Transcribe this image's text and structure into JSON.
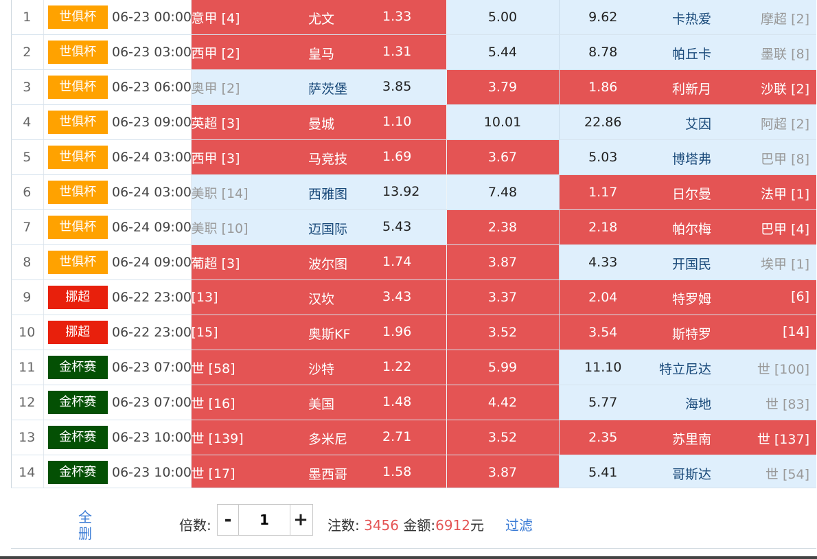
{
  "league_colors": {
    "世俱杯": "#ffa200",
    "挪超": "#e8200c",
    "金杯赛": "#045004"
  },
  "matches": [
    {
      "no": "1",
      "league": "世俱杯",
      "time": "06-23 00:00",
      "home_rank": "意甲 [4]",
      "home": "尤文",
      "home_odds": "1.33",
      "draw_odds": "5.00",
      "away_odds": "9.62",
      "away": "卡热爱",
      "away_rank": "摩超 [2]",
      "sel": [
        1,
        0,
        0
      ]
    },
    {
      "no": "2",
      "league": "世俱杯",
      "time": "06-23 03:00",
      "home_rank": "西甲 [2]",
      "home": "皇马",
      "home_odds": "1.31",
      "draw_odds": "5.44",
      "away_odds": "8.78",
      "away": "帕丘卡",
      "away_rank": "墨联 [8]",
      "sel": [
        1,
        0,
        0
      ]
    },
    {
      "no": "3",
      "league": "世俱杯",
      "time": "06-23 06:00",
      "home_rank": "奥甲 [2]",
      "home": "萨茨堡",
      "home_odds": "3.85",
      "draw_odds": "3.79",
      "away_odds": "1.86",
      "away": "利新月",
      "away_rank": "沙联 [2]",
      "sel": [
        0,
        1,
        1
      ]
    },
    {
      "no": "4",
      "league": "世俱杯",
      "time": "06-23 09:00",
      "home_rank": "英超 [3]",
      "home": "曼城",
      "home_odds": "1.10",
      "draw_odds": "10.01",
      "away_odds": "22.86",
      "away": "艾因",
      "away_rank": "阿超 [2]",
      "sel": [
        1,
        0,
        0
      ]
    },
    {
      "no": "5",
      "league": "世俱杯",
      "time": "06-24 03:00",
      "home_rank": "西甲 [3]",
      "home": "马竞技",
      "home_odds": "1.69",
      "draw_odds": "3.67",
      "away_odds": "5.03",
      "away": "博塔弗",
      "away_rank": "巴甲 [8]",
      "sel": [
        1,
        1,
        0
      ]
    },
    {
      "no": "6",
      "league": "世俱杯",
      "time": "06-24 03:00",
      "home_rank": "美职 [14]",
      "home": "西雅图",
      "home_odds": "13.92",
      "draw_odds": "7.48",
      "away_odds": "1.17",
      "away": "日尔曼",
      "away_rank": "法甲 [1]",
      "sel": [
        0,
        0,
        1
      ]
    },
    {
      "no": "7",
      "league": "世俱杯",
      "time": "06-24 09:00",
      "home_rank": "美职 [10]",
      "home": "迈国际",
      "home_odds": "5.43",
      "draw_odds": "2.38",
      "away_odds": "2.18",
      "away": "帕尔梅",
      "away_rank": "巴甲 [4]",
      "sel": [
        0,
        1,
        1
      ]
    },
    {
      "no": "8",
      "league": "世俱杯",
      "time": "06-24 09:00",
      "home_rank": "葡超 [3]",
      "home": "波尔图",
      "home_odds": "1.74",
      "draw_odds": "3.87",
      "away_odds": "4.33",
      "away": "开国民",
      "away_rank": "埃甲 [1]",
      "sel": [
        1,
        1,
        0
      ]
    },
    {
      "no": "9",
      "league": "挪超",
      "time": "06-22 23:00",
      "home_rank": "[13]",
      "home": "汉坎",
      "home_odds": "3.43",
      "draw_odds": "3.37",
      "away_odds": "2.04",
      "away": "特罗姆",
      "away_rank": "[6]",
      "sel": [
        1,
        1,
        1
      ]
    },
    {
      "no": "10",
      "league": "挪超",
      "time": "06-22 23:00",
      "home_rank": "[15]",
      "home": "奥斯KF",
      "home_odds": "1.96",
      "draw_odds": "3.52",
      "away_odds": "3.54",
      "away": "斯特罗",
      "away_rank": "[14]",
      "sel": [
        1,
        1,
        1
      ]
    },
    {
      "no": "11",
      "league": "金杯赛",
      "time": "06-23 07:00",
      "home_rank": "世 [58]",
      "home": "沙特",
      "home_odds": "1.22",
      "draw_odds": "5.99",
      "away_odds": "11.10",
      "away": "特立尼达",
      "away_rank": "世 [100]",
      "sel": [
        1,
        1,
        0
      ]
    },
    {
      "no": "12",
      "league": "金杯赛",
      "time": "06-23 07:00",
      "home_rank": "世 [16]",
      "home": "美国",
      "home_odds": "1.48",
      "draw_odds": "4.42",
      "away_odds": "5.77",
      "away": "海地",
      "away_rank": "世 [83]",
      "sel": [
        1,
        1,
        0
      ]
    },
    {
      "no": "13",
      "league": "金杯赛",
      "time": "06-23 10:00",
      "home_rank": "世 [139]",
      "home": "多米尼",
      "home_odds": "2.71",
      "draw_odds": "3.52",
      "away_odds": "2.35",
      "away": "苏里南",
      "away_rank": "世 [137]",
      "sel": [
        1,
        1,
        1
      ]
    },
    {
      "no": "14",
      "league": "金杯赛",
      "time": "06-23 10:00",
      "home_rank": "世 [17]",
      "home": "墨西哥",
      "home_odds": "1.58",
      "draw_odds": "3.87",
      "away_odds": "5.41",
      "away": "哥斯达",
      "away_rank": "世 [54]",
      "sel": [
        1,
        1,
        0
      ]
    }
  ],
  "footer": {
    "clear_label": "全删",
    "multiplier_label": "倍数:",
    "minus": "-",
    "plus": "+",
    "multiplier_value": "1",
    "bets_label": "注数:",
    "bets_value": "3456",
    "amount_label": "金额:",
    "amount_value": "6912",
    "amount_unit": "元",
    "filter_label": "过滤"
  }
}
